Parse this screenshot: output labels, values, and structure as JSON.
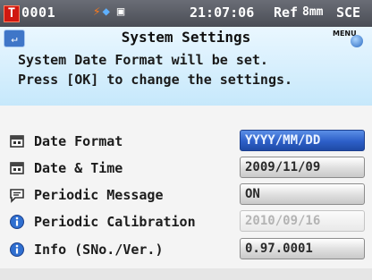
{
  "status_bar": {
    "target_badge": "T",
    "target_number": "0001",
    "time": "21:07:06",
    "ref": "Ref",
    "aperture": "8mm",
    "mode": "SCE",
    "icons": [
      "power-icon",
      "battery-icon",
      "printer-icon"
    ]
  },
  "header": {
    "back_icon": "back-icon",
    "title": "System Settings",
    "menu_label": "MENU",
    "message_line1": "System Date Format will be set.",
    "message_line2": "Press [OK] to change the settings."
  },
  "settings": [
    {
      "icon": "calendar-icon",
      "label": "Date Format",
      "value": "YYYY/MM/DD",
      "state": "selected"
    },
    {
      "icon": "calendar-icon",
      "label": "Date & Time",
      "value": "2009/11/09",
      "state": "normal"
    },
    {
      "icon": "message-icon",
      "label": "Periodic Message",
      "value": "ON",
      "state": "normal"
    },
    {
      "icon": "info-icon",
      "label": "Periodic Calibration",
      "value": "2010/09/16",
      "state": "disabled"
    },
    {
      "icon": "info-icon",
      "label": "Info (SNo./Ver.)",
      "value": "0.97.0001",
      "state": "normal"
    }
  ],
  "colors": {
    "status_bar": "#55585f",
    "header_bg": "#d6eefc",
    "selected": "#2d5fc8",
    "badge": "#d01810"
  }
}
